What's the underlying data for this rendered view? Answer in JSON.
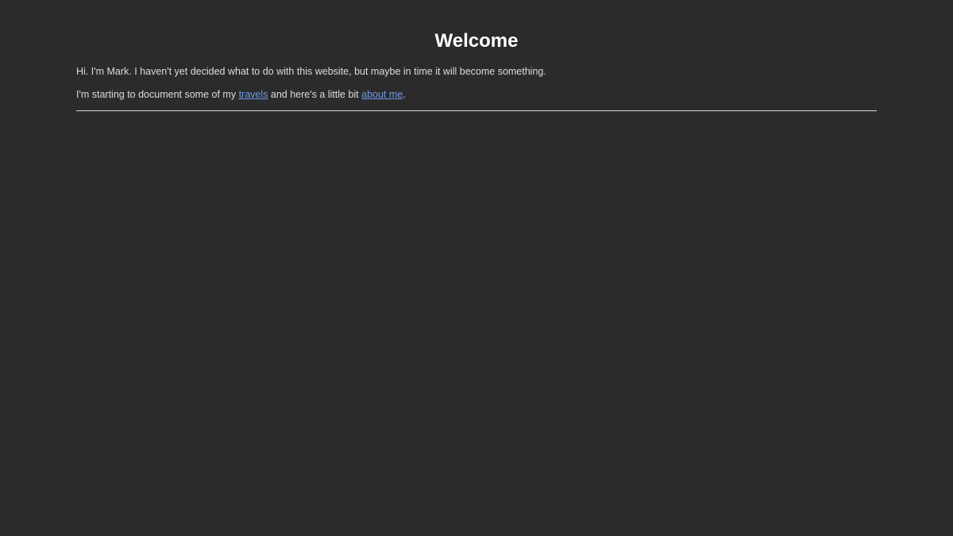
{
  "page": {
    "title": "Welcome",
    "intro": "Hi. I'm Mark. I haven't yet decided what to do with this website, but maybe in time it will become something.",
    "second_line": {
      "before_travels": "I'm starting to document some of my ",
      "travels_link": "travels",
      "middle": " and here's a little bit ",
      "about_link": "about me",
      "after": "."
    }
  },
  "colors": {
    "background": "#2b2b2b",
    "text": "#dcdcdc",
    "heading": "#ffffff",
    "link": "#6e9be8"
  }
}
